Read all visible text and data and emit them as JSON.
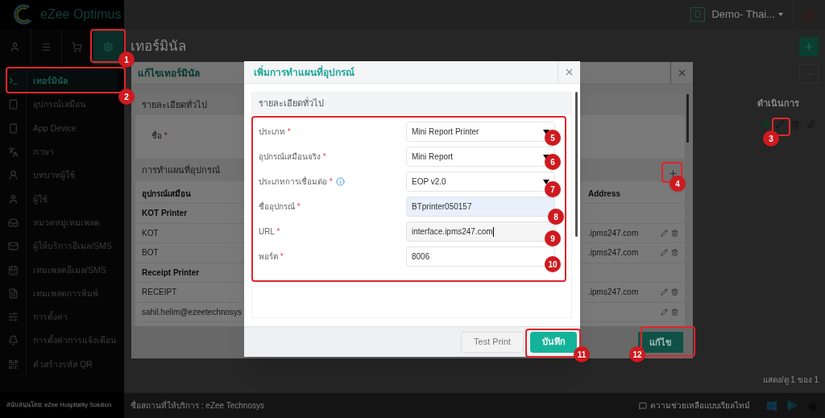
{
  "app": {
    "logo_text": "eZee Optimus",
    "property_initial": "D",
    "property_name": "Demo- Thai..."
  },
  "top_tabs": [
    {
      "kind": "user",
      "selected": false
    },
    {
      "kind": "menu",
      "selected": false
    },
    {
      "kind": "cart",
      "selected": false
    },
    {
      "kind": "settings",
      "selected": true
    }
  ],
  "sidebar": {
    "items": [
      {
        "label": "เทอร์มินัล",
        "selected": true
      },
      {
        "label": "อุปกรณ์เสมือน",
        "selected": false
      },
      {
        "label": "App Device",
        "selected": false
      },
      {
        "label": "ภาษา",
        "selected": false
      },
      {
        "label": "บทบาทผู้ใช้",
        "selected": false
      },
      {
        "label": "ผู้ใช้",
        "selected": false
      },
      {
        "label": "หมวดหมู่เทมเพลต",
        "selected": false
      },
      {
        "label": "ผู้ให้บริการอีเมล/SMS",
        "selected": false
      },
      {
        "label": "เทมเพลตอีเมล/SMS",
        "selected": false
      },
      {
        "label": "เทมเพลตการพิมพ์",
        "selected": false
      },
      {
        "label": "การตั้งค่า",
        "selected": false
      },
      {
        "label": "การตั้งค่าการแจ้งเตือน",
        "selected": false
      },
      {
        "label": "ตัวสร้างรหัส QR",
        "selected": false
      }
    ]
  },
  "page_title": "เทอร์มินัล",
  "actions_header": "ดำเนินการ",
  "row_active": true,
  "pagination": "แสดง/ดู 1 ของ 1",
  "footer": {
    "powered_by": "สนับสนุนโดย: eZee Hospitality Solution",
    "venue": "ชื่อสถานที่ให้บริการ : eZee Technosys",
    "help": "ความช่วยเหลือแบบเรียลไทม์"
  },
  "edit_dialog": {
    "title": "แก้ไขเทอร์มินัล",
    "general_section": "รายละเอียดทั่วไป",
    "name_label": "ชื่อ",
    "name_required_mark": "*",
    "mapping_section": "การทำแผนที่อุปกรณ์",
    "columns": [
      "อุปกรณ์เสมือน",
      "Address"
    ],
    "rows": [
      {
        "kind": "group",
        "cells": [
          "KOT Printer"
        ]
      },
      {
        "kind": "item",
        "cells": [
          "KOT",
          ".ipms247.com"
        ]
      },
      {
        "kind": "item",
        "cells": [
          "BOT",
          ".ipms247.com"
        ]
      },
      {
        "kind": "group",
        "cells": [
          "Receipt Printer"
        ]
      },
      {
        "kind": "item",
        "cells": [
          "RECEIPT",
          ".ipms247.com"
        ]
      },
      {
        "kind": "item",
        "cells": [
          "sahil.helim@ezeetechnosys"
        ]
      }
    ],
    "submit": "แก้ไข"
  },
  "add_dialog": {
    "title": "เพิ่มการทำแผนที่อุปกรณ์",
    "section": "รายละเอียดทั่วไป",
    "fields": [
      {
        "label": "ประเภท",
        "required_mark": "*",
        "kind": "select",
        "value": "Mini Report Printer",
        "info": false,
        "autofilled": false,
        "focused": false
      },
      {
        "label": "อุปกรณ์เสมือนจริง",
        "required_mark": "*",
        "kind": "select",
        "value": "Mini Report",
        "info": false,
        "autofilled": false,
        "focused": false
      },
      {
        "label": "ประเภทการเชื่อมต่อ",
        "required_mark": "*",
        "kind": "select",
        "value": "EOP v2.0",
        "info": true,
        "autofilled": false,
        "focused": false
      },
      {
        "label": "ชื่ออุปกรณ์",
        "required_mark": "*",
        "kind": "text",
        "value": "BTprinter050157",
        "info": false,
        "autofilled": true,
        "focused": false
      },
      {
        "label": "URL",
        "required_mark": "*",
        "kind": "text",
        "value": "interface.ipms247.com",
        "info": false,
        "autofilled": false,
        "focused": true
      },
      {
        "label": "พอร์ต",
        "required_mark": "*",
        "kind": "text",
        "value": "8006",
        "info": false,
        "autofilled": false,
        "focused": false
      }
    ],
    "buttons": [
      {
        "label": "Test Print",
        "kind": "secondary"
      },
      {
        "label": "บันทึก",
        "kind": "primary"
      }
    ]
  },
  "annotations": [
    "1",
    "2",
    "3",
    "4",
    "5",
    "6",
    "7",
    "8",
    "9",
    "10",
    "11",
    "12"
  ]
}
